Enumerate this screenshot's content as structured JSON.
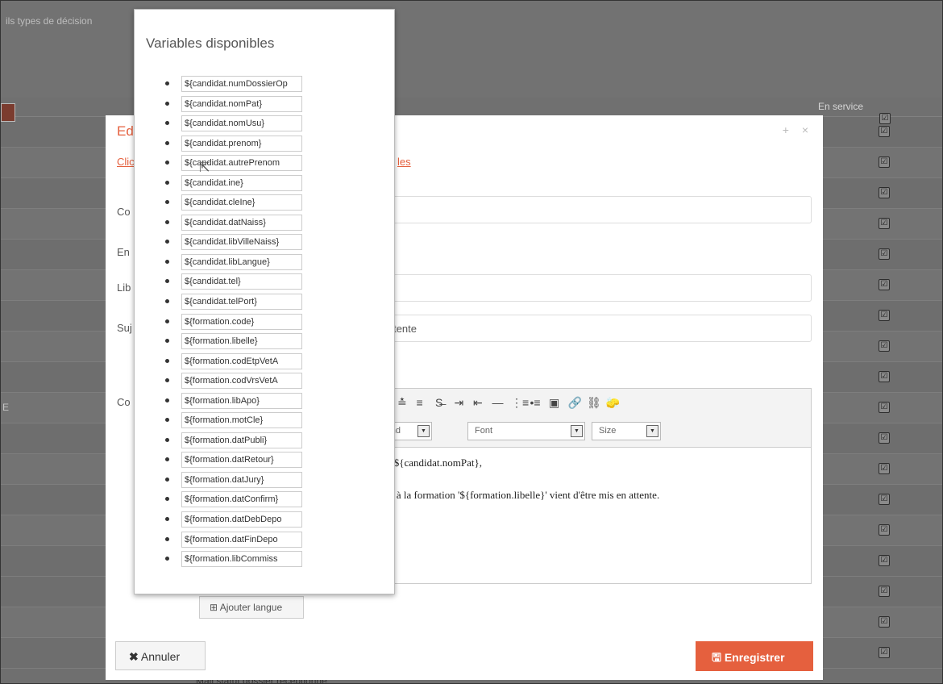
{
  "background": {
    "title": "ils types de décision",
    "column_header": "En service",
    "row_letter": "E",
    "bottom_text": "Mail statut dossier réceptionné",
    "checkbox_symbol": "☑"
  },
  "modal": {
    "title": "Ed",
    "close_symbols": "+ ×",
    "help_link_start": "Clic",
    "help_link_end": "les",
    "labels": {
      "code": "Co",
      "enabled": "En",
      "libelle": "Lib",
      "sujet": "Suj",
      "contenu": "Co"
    },
    "sujet_value_visible": "er en attente",
    "editor": {
      "toolbar_icons": [
        "x²",
        "≣",
        "≛",
        "≡",
        "S̶",
        "⇥",
        "⇤",
        "—",
        "⋮≡",
        "•≡",
        "▣",
        "🔗",
        "⛓",
        "🧽"
      ],
      "foreground_label": "reground",
      "font_label": "Font",
      "size_label": "Size",
      "content_line1": "renom} ${candidat.nomPat},",
      "content_line2": "didature à la formation '${formation.libelle}' vient d'être mis en attente."
    },
    "add_language_button": "Ajouter langue",
    "cancel_button": "Annuler",
    "save_button": "Enregistrer"
  },
  "variables_popup": {
    "title": "Variables disponibles",
    "items": [
      "${candidat.numDossierOp",
      "${candidat.nomPat}",
      "${candidat.nomUsu}",
      "${candidat.prenom}",
      "${candidat.autrePrenom",
      "${candidat.ine}",
      "${candidat.cleIne}",
      "${candidat.datNaiss}",
      "${candidat.libVilleNaiss}",
      "${candidat.libLangue}",
      "${candidat.tel}",
      "${candidat.telPort}",
      "${formation.code}",
      "${formation.libelle}",
      "${formation.codEtpVetA",
      "${formation.codVrsVetA",
      "${formation.libApo}",
      "${formation.motCle}",
      "${formation.datPubli}",
      "${formation.datRetour}",
      "${formation.datJury}",
      "${formation.datConfirm}",
      "${formation.datDebDepo",
      "${formation.datFinDepo",
      "${formation.libCommiss"
    ]
  }
}
